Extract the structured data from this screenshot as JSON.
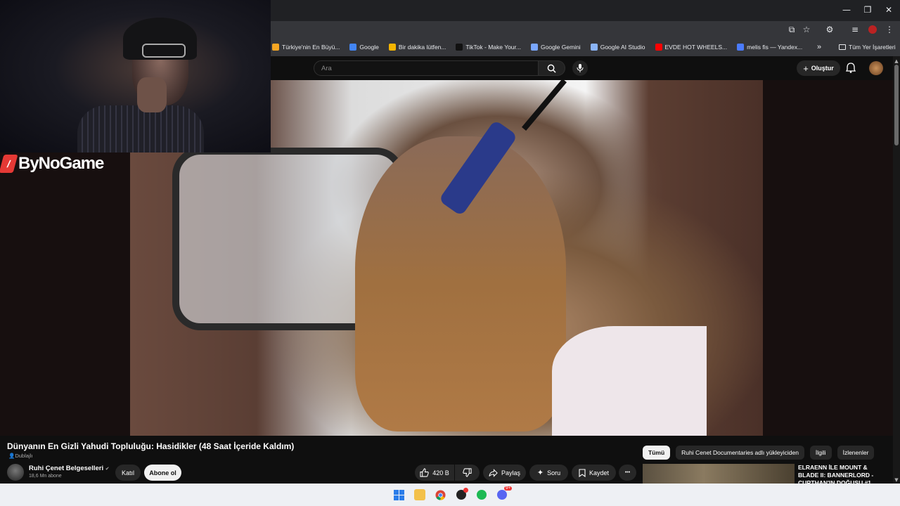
{
  "window": {
    "controls": {
      "minimize": "—",
      "restore": "❐",
      "close": "✕"
    }
  },
  "bookmarks": [
    {
      "label": "Türkiye'nin En Büyü...",
      "color": "#f6a623"
    },
    {
      "label": "Google",
      "color": "#4285f4"
    },
    {
      "label": "Bir dakika lütfen...",
      "color": "#f4b400"
    },
    {
      "label": "TikTok - Make Your...",
      "color": "#111111"
    },
    {
      "label": "Google Gemini",
      "color": "#7aa7ff"
    },
    {
      "label": "Google AI Studio",
      "color": "#8ab4f8"
    },
    {
      "label": "EVDE HOT WHEELS...",
      "color": "#ff0000"
    },
    {
      "label": "melis fis — Yandex...",
      "color": "#4a7bff"
    }
  ],
  "bookmarks_overflow": "»",
  "all_bookmarks": "Tüm Yer İşaretleri",
  "header": {
    "search_placeholder": "Ara",
    "create_label": "Oluştur"
  },
  "overlay": {
    "brand": "ByNoGame"
  },
  "video": {
    "title": "Dünyanın En Gizli Yahudi Topluluğu: Hasidikler (48 Saat İçeride Kaldım)",
    "dubbed": "Dublajlı"
  },
  "channel": {
    "name": "Ruhi Çenet Belgeselleri",
    "verified": "✔",
    "subscribers": "18,6 Mn abone",
    "join": "Katıl",
    "subscribe": "Abone ol"
  },
  "actions": {
    "likes": "420 B",
    "share": "Paylaş",
    "ask": "Soru",
    "save": "Kaydet",
    "more": "•••"
  },
  "chips": [
    "Tümü",
    "Ruhi Cenet Documentaries adlı yükleyiciden",
    "İlgili",
    "İzlenenler"
  ],
  "related": {
    "title": "ELRAENN İLE MOUNT & BLADE II: BANNERLORD - CURTHAN'IN DOĞUŞU #1"
  },
  "taskbar": {
    "badge": "9+"
  }
}
